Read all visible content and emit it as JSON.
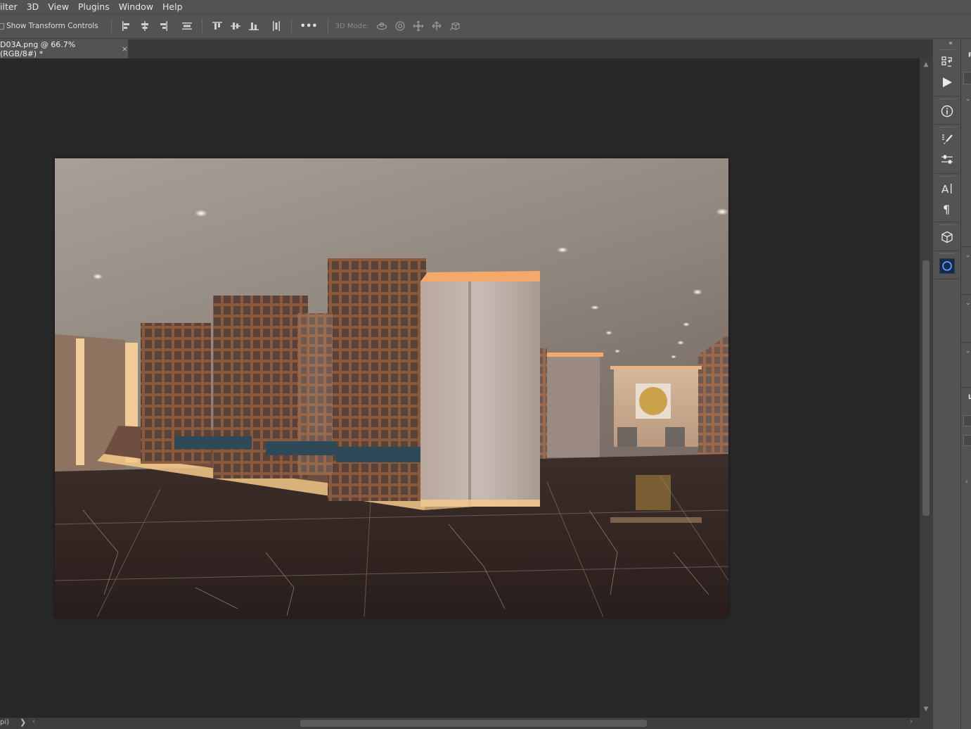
{
  "menu": {
    "items": [
      "ilter",
      "3D",
      "View",
      "Plugins",
      "Window",
      "Help"
    ]
  },
  "options": {
    "show_transform_label": "Show Transform Controls",
    "mode_3d_label": "3D Mode:",
    "more_label": "•••"
  },
  "document": {
    "tab_title": "D03A.png @ 66.7% (RGB/8#) *",
    "close_glyph": "×"
  },
  "status": {
    "zoom_text": "pi)",
    "chevron": "❯",
    "left_arrow": "‹",
    "right_arrow": "›"
  },
  "panels": {
    "collapse_glyph": "«",
    "right_title_1": "P",
    "right_title_2": "L"
  },
  "colors": {
    "canvas_bg": "#282828",
    "ui_bg": "#535353",
    "accent": "#1e73e8"
  },
  "icons": [
    "align-left-icon",
    "align-center-h-icon",
    "align-right-icon",
    "distribute-h-icon",
    "align-top-icon",
    "align-middle-v-icon",
    "align-bottom-icon",
    "distribute-v-icon",
    "orbit-3d-icon",
    "roll-3d-icon",
    "drag-3d-icon",
    "slide-3d-icon",
    "scale-3d-icon",
    "history-icon",
    "play-action-icon",
    "info-icon",
    "brush-presets-icon",
    "adjustments-icon",
    "character-icon",
    "paragraph-icon",
    "3d-panel-icon",
    "properties-icon"
  ]
}
